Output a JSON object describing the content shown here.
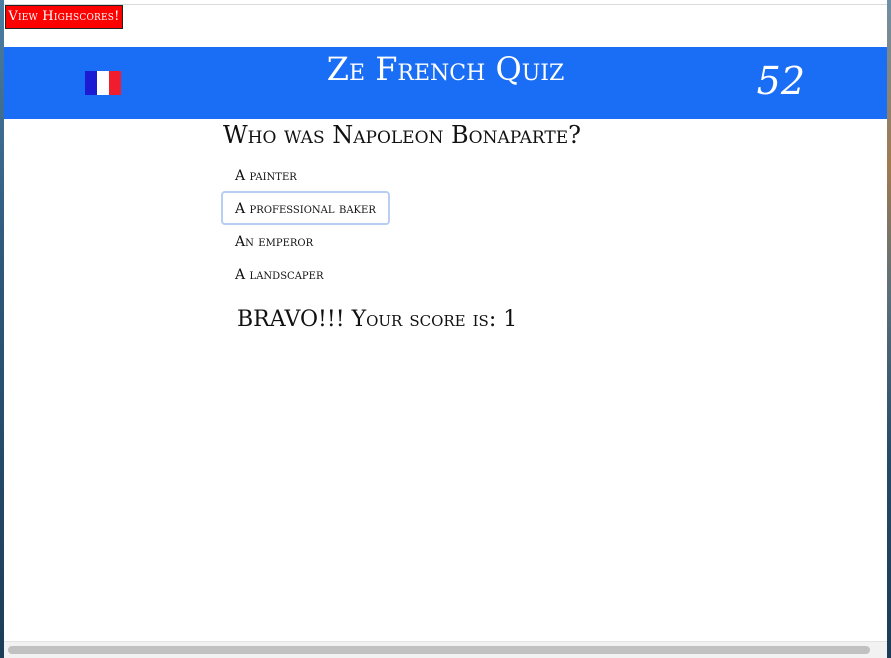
{
  "header_button": {
    "label": "View Highscores!"
  },
  "header": {
    "title": "Ze French Quiz",
    "timer": "52",
    "flag_colors": [
      "#1b1bd3",
      "#ffffff",
      "#f21c2f"
    ],
    "background": "#1a6ef5"
  },
  "quiz": {
    "question": "Who was Napoleon Bonaparte?",
    "answers": [
      {
        "label": "A painter"
      },
      {
        "label": "A professional baker",
        "focused": true
      },
      {
        "label": "An emperor"
      },
      {
        "label": "A landscaper"
      }
    ],
    "result": "BRAVO!!! Your score is: 1"
  },
  "colors": {
    "highscore_button": "#ff0000",
    "focus_ring": "#b8cff3"
  }
}
